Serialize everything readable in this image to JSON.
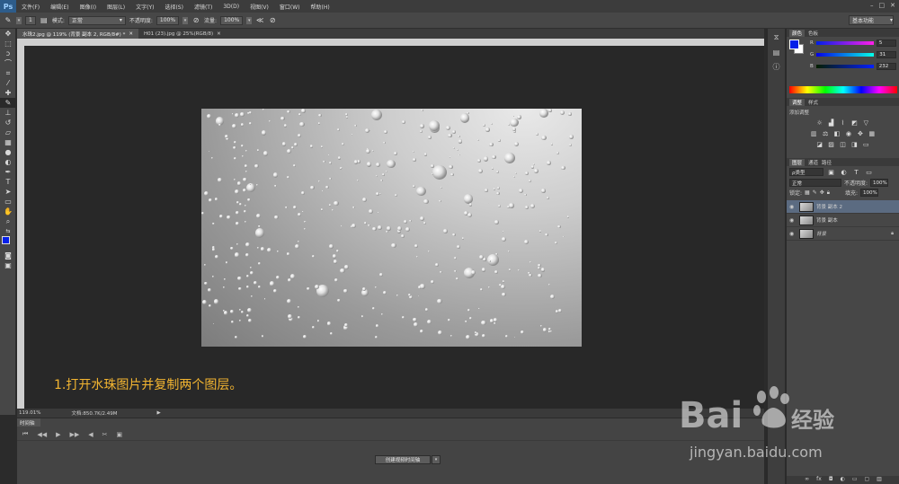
{
  "app": {
    "logo": "Ps"
  },
  "menu": [
    "文件(F)",
    "编辑(E)",
    "图像(I)",
    "图层(L)",
    "文字(Y)",
    "选择(S)",
    "滤镜(T)",
    "3D(D)",
    "视图(V)",
    "窗口(W)",
    "帮助(H)"
  ],
  "window_controls": [
    "–",
    "□",
    "✕"
  ],
  "options": {
    "brush_size": "1",
    "mode_label": "模式:",
    "mode_value": "正常",
    "opacity_label": "不透明度:",
    "opacity_value": "100%",
    "flow_label": "流量:",
    "flow_value": "100%",
    "workspace": "基本功能"
  },
  "tabs": [
    {
      "label": "水珠2.jpg @ 119% (背景 副本 2, RGB/8#) *",
      "active": true
    },
    {
      "label": "H01 (23).jpg @ 25%(RGB/8)",
      "active": false
    }
  ],
  "canvas": {
    "caption": "1.打开水珠图片并复制两个图层。"
  },
  "status": {
    "zoom": "119.01%",
    "doc": "文档:850.7K/2.49M"
  },
  "timeline": {
    "tab": "时间轴",
    "create_button": "创建视频时间轴"
  },
  "color_panel": {
    "tabs": [
      "颜色",
      "色板"
    ],
    "channels": [
      {
        "name": "R",
        "value": "5"
      },
      {
        "name": "G",
        "value": "31"
      },
      {
        "name": "B",
        "value": "232"
      }
    ],
    "foreground": "#051fe8"
  },
  "adjust_panel": {
    "tabs": [
      "调整",
      "样式"
    ],
    "title": "添加调整"
  },
  "layers_panel": {
    "tabs": [
      "图层",
      "通道",
      "路径"
    ],
    "filter": "ρ类型",
    "blend": "正常",
    "opacity_label": "不透明度:",
    "opacity": "100%",
    "lock_label": "锁定:",
    "fill_label": "填充:",
    "fill": "100%",
    "layers": [
      {
        "name": "背景 副本 2",
        "selected": true
      },
      {
        "name": "背景 副本",
        "selected": false
      },
      {
        "name": "背景",
        "selected": false
      }
    ]
  },
  "watermark": {
    "brand": "Bai",
    "brand2": "经验",
    "url": "jingyan.baidu.com"
  }
}
